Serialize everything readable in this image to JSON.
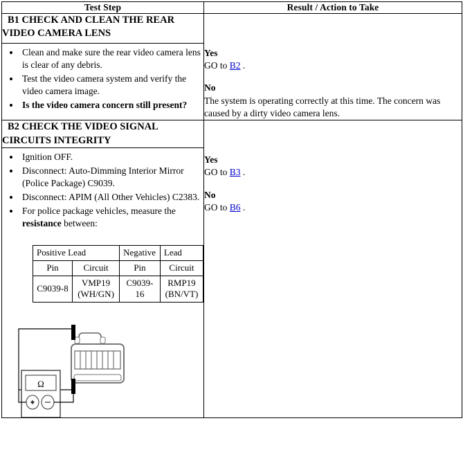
{
  "table": {
    "headers": {
      "test_step": "Test Step",
      "result_action": "Result / Action to Take"
    }
  },
  "steps": [
    {
      "id": "B1",
      "title": "B1 CHECK AND CLEAN THE REAR VIDEO CAMERA LENS",
      "bullets": [
        {
          "text": "Clean and make sure the rear video camera lens is clear of any debris.",
          "bold": false
        },
        {
          "text": "Test the video camera system and verify the video camera image.",
          "bold": false
        },
        {
          "text": "Is the video camera concern still present?",
          "bold": true
        }
      ],
      "result": {
        "yes_label": "Yes",
        "yes_prefix": "GO to ",
        "yes_link": "B2",
        "yes_suffix": " .",
        "no_label": "No",
        "no_text": "The system is operating correctly at this time. The concern was caused by a dirty video camera lens."
      }
    },
    {
      "id": "B2",
      "title": "B2 CHECK THE VIDEO SIGNAL CIRCUITS INTEGRITY",
      "bullets": [
        {
          "text": "Ignition OFF.",
          "bold": false
        },
        {
          "text": "Disconnect: Auto-Dimming Interior Mirror (Police Package) C9039.",
          "bold": false
        },
        {
          "text": "Disconnect: APIM (All Other Vehicles) C2383.",
          "bold": false
        },
        {
          "text": "For police package vehicles, measure the resistance between:",
          "bold": false,
          "bold_word": "resistance"
        }
      ],
      "result": {
        "yes_label": "Yes",
        "yes_prefix": "GO to ",
        "yes_link": "B3",
        "yes_suffix": " .",
        "no_label": "No",
        "no_prefix": "GO to ",
        "no_link": "B6",
        "no_suffix": " ."
      }
    }
  ],
  "pin_table": {
    "group_headers": {
      "positive": "Positive Lead",
      "negative": "Negative Lead"
    },
    "column_headers": [
      "Pin",
      "Circuit",
      "Pin",
      "Circuit"
    ],
    "rows": [
      [
        "C9039-8",
        "VMP19 (WH/GN)",
        "C9039-16",
        "RMP19 (BN/VT)"
      ]
    ]
  },
  "diagram": {
    "name": "resistance-measurement-diagram",
    "meter_display": "Ω",
    "positive_terminal": "+",
    "negative_terminal": "−",
    "connector_cavities": 8
  },
  "colors": {
    "link": "#0000cc",
    "border": "#000000",
    "text": "#000000",
    "background": "#ffffff"
  }
}
